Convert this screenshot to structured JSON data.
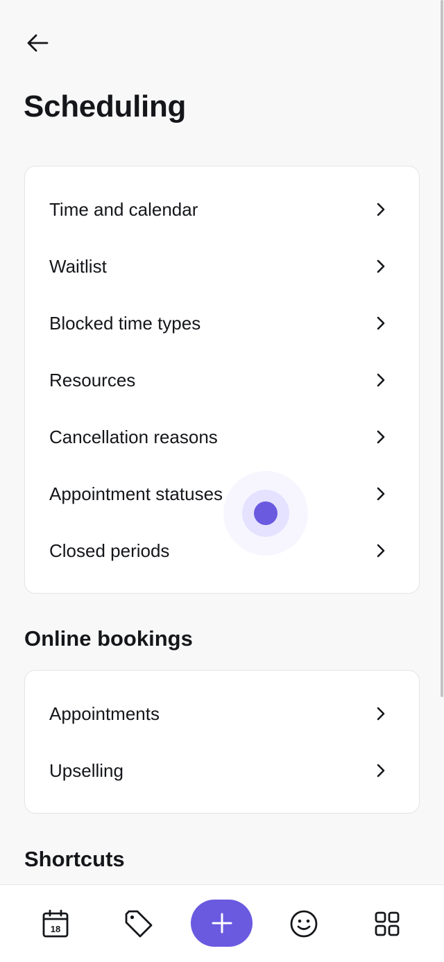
{
  "header": {
    "back_icon": "arrow-left-icon",
    "title": "Scheduling"
  },
  "scheduling": {
    "items": [
      {
        "label": "Time and calendar"
      },
      {
        "label": "Waitlist"
      },
      {
        "label": "Blocked time types"
      },
      {
        "label": "Resources"
      },
      {
        "label": "Cancellation reasons"
      },
      {
        "label": "Appointment statuses"
      },
      {
        "label": "Closed periods"
      }
    ]
  },
  "online_bookings": {
    "title": "Online bookings",
    "items": [
      {
        "label": "Appointments"
      },
      {
        "label": "Upselling"
      }
    ]
  },
  "shortcuts": {
    "title": "Shortcuts"
  },
  "bottom_nav": {
    "calendar_icon": "calendar-icon",
    "calendar_day": "18",
    "tag_icon": "tag-icon",
    "add_icon": "plus-icon",
    "clients_icon": "smile-icon",
    "more_icon": "grid-icon"
  },
  "colors": {
    "accent": "#6a5ae0",
    "background": "#f8f8f8",
    "card": "#ffffff",
    "text": "#14161a"
  }
}
